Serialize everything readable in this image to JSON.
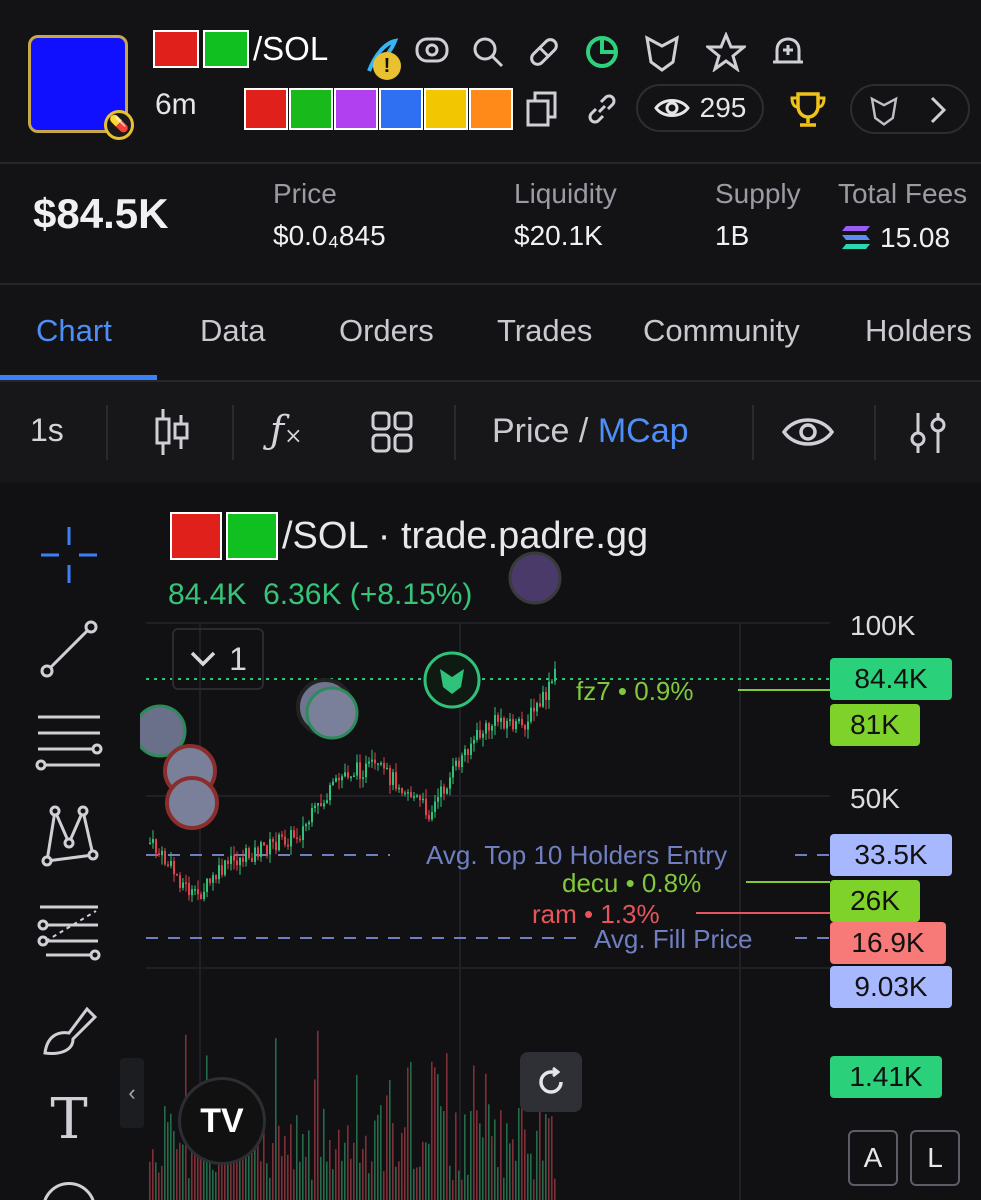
{
  "header": {
    "pair_quote": "/SOL",
    "age": "6m",
    "watchers": "295",
    "token_colors": [
      "#e0201a",
      "#10c020"
    ],
    "palette": [
      "#e0201a",
      "#18b91a",
      "#b040f0",
      "#2f70f2",
      "#f2c600",
      "#ff8a1a"
    ]
  },
  "stats": {
    "market_cap": "$84.5K",
    "price_label": "Price",
    "price_value": "$0.0₄845",
    "liquidity_label": "Liquidity",
    "liquidity_value": "$20.1K",
    "supply_label": "Supply",
    "supply_value": "1B",
    "fees_label": "Total Fees",
    "fees_value": "15.08"
  },
  "tabs": [
    "Chart",
    "Data",
    "Orders",
    "Trades",
    "Community",
    "Holders"
  ],
  "toolbar": {
    "interval": "1s",
    "price_label": "Price",
    "slash": " / ",
    "mcap_label": "MCap"
  },
  "chart": {
    "title_suffix": "/SOL · trade.padre.gg",
    "ohlc": "84.4K  6.36K (+8.15%)",
    "collapse_count": "1",
    "axis_top": "100K",
    "axis_mid": "50K",
    "tags": {
      "current": "84.4K",
      "fz7": "81K",
      "top10": "33.5K",
      "decu": "26K",
      "fill": "16.9K",
      "low": "9.03K",
      "volume": "1.41K"
    },
    "labels": {
      "fz7": "fz7 • 0.9%",
      "top10": "Avg. Top 10 Holders Entry",
      "decu": "decu • 0.8%",
      "ram": "ram • 1.3%",
      "fill": "Avg. Fill Price"
    },
    "colors": {
      "up": "#2fc27a",
      "down": "#e0434b",
      "tag_green": "#2bd07a",
      "tag_lime": "#7fd22a",
      "tag_blue": "#a8b8ff",
      "tag_red": "#f77a78",
      "line_fz7": "#80c93a",
      "line_top10": "#6f7fc0",
      "line_ram": "#e4555c"
    },
    "scale_buttons": [
      "A",
      "L"
    ],
    "logo_text": "TV"
  }
}
